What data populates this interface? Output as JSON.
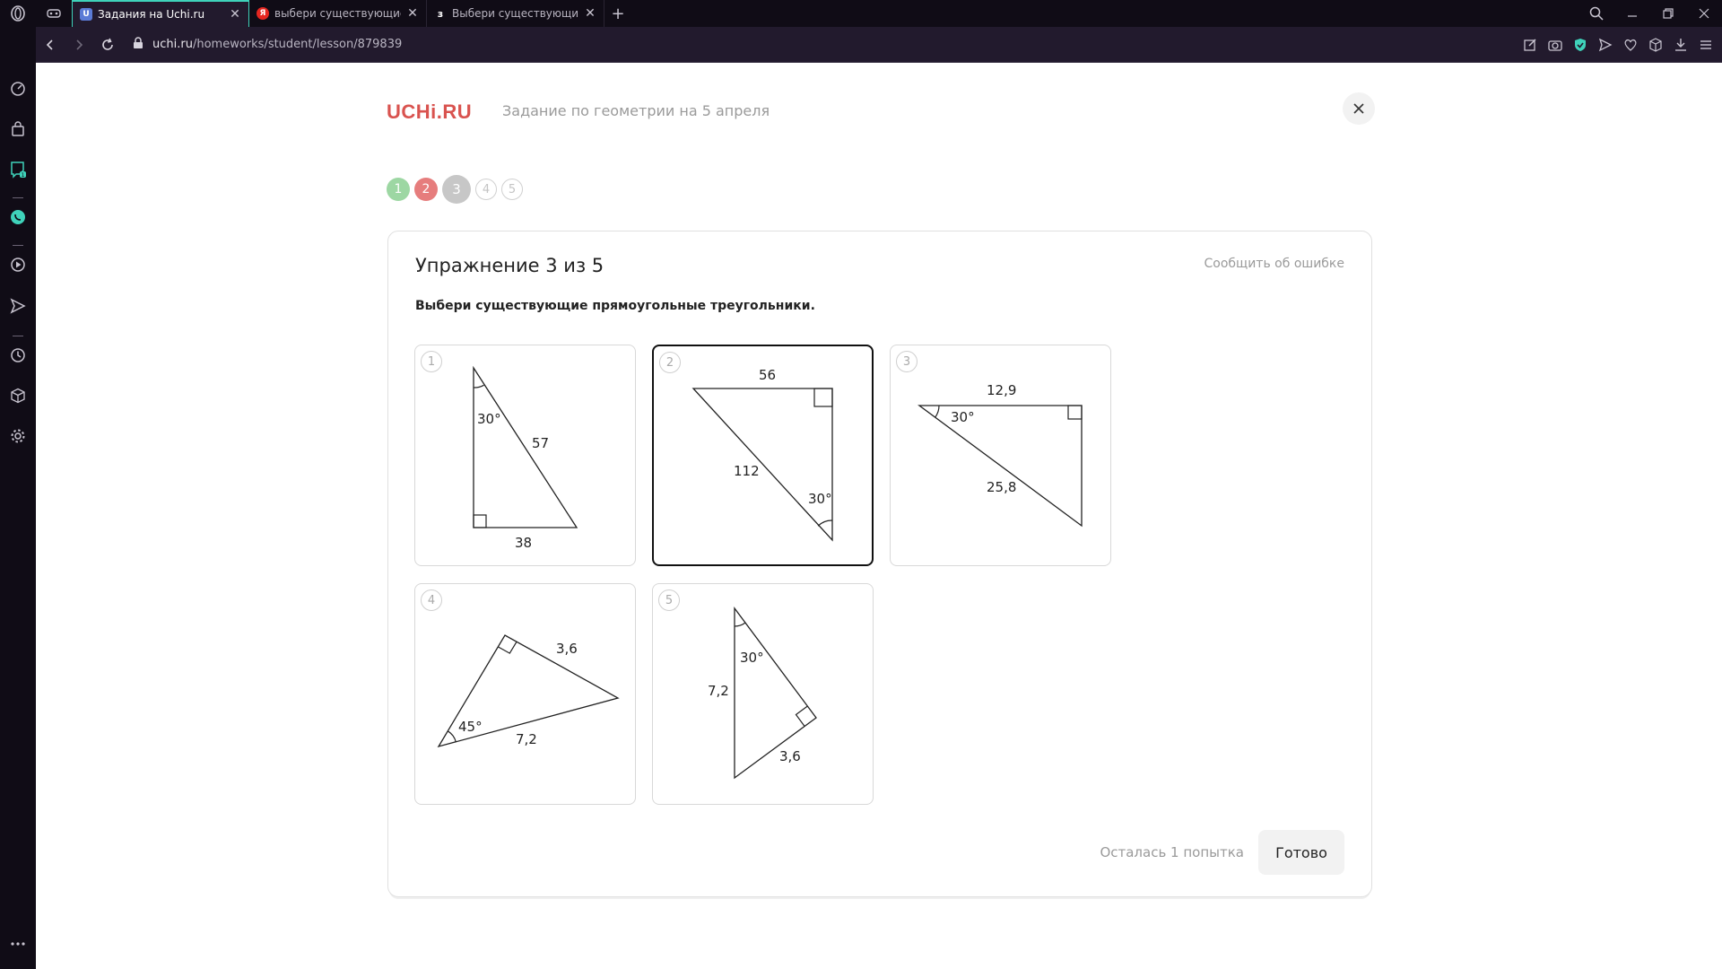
{
  "browser": {
    "tabs": [
      {
        "title": "Задания на Uchi.ru",
        "active": true
      },
      {
        "title": "выбери существующие пр",
        "active": false
      },
      {
        "title": "Выбери существующие пр",
        "active": false
      }
    ],
    "url_host": "uchi.ru",
    "url_path": "/homeworks/student/lesson/879839",
    "sidebar_badge": "1"
  },
  "header": {
    "logo": "UCHi.RU",
    "lesson_title": "Задание по геометрии на 5 апреля"
  },
  "steps": [
    {
      "label": "1",
      "state": "done"
    },
    {
      "label": "2",
      "state": "wrong"
    },
    {
      "label": "3",
      "state": "current"
    },
    {
      "label": "4",
      "state": "todo"
    },
    {
      "label": "5",
      "state": "todo"
    }
  ],
  "exercise": {
    "title": "Упражнение 3 из 5",
    "report_label": "Сообщить об ошибке",
    "instruction": "Выбери существующие прямоугольные треугольники.",
    "options": [
      {
        "num": "1",
        "selected": false,
        "labels": [
          "30°",
          "57",
          "38"
        ]
      },
      {
        "num": "2",
        "selected": true,
        "labels": [
          "56",
          "112",
          "30°"
        ]
      },
      {
        "num": "3",
        "selected": false,
        "labels": [
          "12,9",
          "30°",
          "25,8"
        ]
      },
      {
        "num": "4",
        "selected": false,
        "labels": [
          "3,6",
          "45°",
          "7,2"
        ]
      },
      {
        "num": "5",
        "selected": false,
        "labels": [
          "30°",
          "7,2",
          "3,6"
        ]
      }
    ],
    "attempts_label": "Осталась 1 попытка",
    "submit_label": "Готово"
  },
  "colors": {
    "accent": "#3fd2ba",
    "brand": "#d9534f",
    "step_done": "#9dd7a3",
    "step_wrong": "#e67d7d",
    "step_current": "#c7c7c7"
  }
}
